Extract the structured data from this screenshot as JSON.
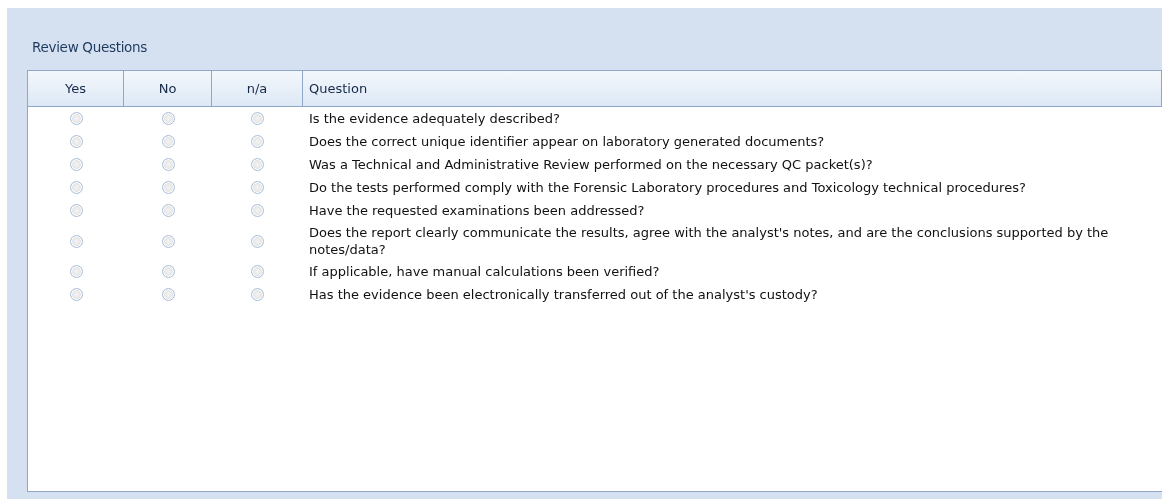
{
  "section_title": "Review Questions",
  "table": {
    "columns": [
      "Yes",
      "No",
      "n/a",
      "Question"
    ],
    "rows": [
      {
        "yes": false,
        "no": false,
        "na": false,
        "question": "Is the evidence adequately described?"
      },
      {
        "yes": false,
        "no": false,
        "na": false,
        "question": "Does the correct unique identifier appear on laboratory generated documents?"
      },
      {
        "yes": false,
        "no": false,
        "na": false,
        "question": "Was a Technical and Administrative Review performed on the necessary QC packet(s)?"
      },
      {
        "yes": false,
        "no": false,
        "na": false,
        "question": "Do the tests performed comply with the Forensic Laboratory procedures and Toxicology technical procedures?"
      },
      {
        "yes": false,
        "no": false,
        "na": false,
        "question": "Have the requested examinations been addressed?"
      },
      {
        "yes": false,
        "no": false,
        "na": false,
        "question": "Does the report clearly communicate the results, agree with the analyst's notes, and are the conclusions supported by the notes/data?"
      },
      {
        "yes": false,
        "no": false,
        "na": false,
        "question": "If applicable, have manual calculations been verified?"
      },
      {
        "yes": false,
        "no": false,
        "na": false,
        "question": "Has the evidence been electronically transferred out of the analyst's custody?"
      }
    ]
  }
}
